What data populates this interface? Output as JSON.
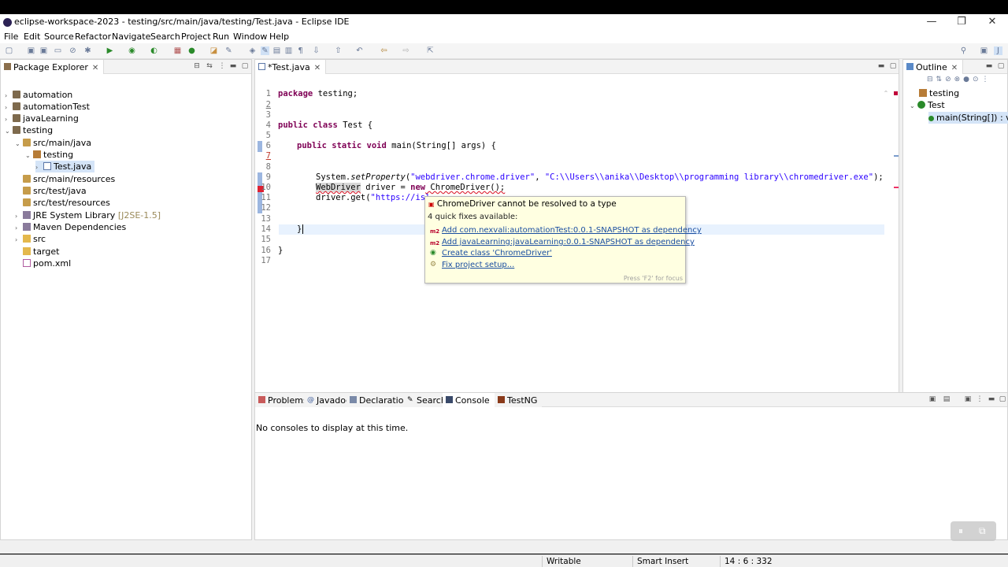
{
  "window": {
    "title": "eclipse-workspace-2023 - testing/src/main/java/testing/Test.java - Eclipse IDE",
    "minimize": "—",
    "maximize": "❐",
    "close": "✕"
  },
  "menu": [
    "File",
    "Edit",
    "Source",
    "Refactor",
    "Navigate",
    "Search",
    "Project",
    "Run",
    "Window",
    "Help"
  ],
  "package_explorer": {
    "tab_label": "Package Explorer",
    "items": [
      {
        "label": "automation",
        "suffix": ""
      },
      {
        "label": "automationTest",
        "suffix": ""
      },
      {
        "label": "javaLearning",
        "suffix": ""
      },
      {
        "label": "testing",
        "suffix": ""
      },
      {
        "label": "src/main/java",
        "suffix": ""
      },
      {
        "label": "testing",
        "suffix": ""
      },
      {
        "label": "Test.java",
        "suffix": ""
      },
      {
        "label": "src/main/resources",
        "suffix": ""
      },
      {
        "label": "src/test/java",
        "suffix": ""
      },
      {
        "label": "src/test/resources",
        "suffix": ""
      },
      {
        "label": "JRE System Library",
        "suffix": "[J2SE-1.5]"
      },
      {
        "label": "Maven Dependencies",
        "suffix": ""
      },
      {
        "label": "src",
        "suffix": ""
      },
      {
        "label": "target",
        "suffix": ""
      },
      {
        "label": "pom.xml",
        "suffix": ""
      }
    ]
  },
  "editor": {
    "tab_label": "*Test.java",
    "line_numbers": [
      "1",
      "2",
      "3",
      "4",
      "5",
      "6",
      "7",
      "8",
      "9",
      "10",
      "11",
      "12",
      "13",
      "14",
      "15",
      "16",
      "17"
    ],
    "lines": {
      "l1_kw": "package",
      "l1_rest": " testing;",
      "l4_kw1": "public",
      "l4_kw2": "class",
      "l4_rest": " Test {",
      "l6_kw1": "public",
      "l6_kw2": "static",
      "l6_kw3": "void",
      "l6_rest": " main(String[] args) {",
      "l9_a": "System.",
      "l9_method": "setProperty",
      "l9_b": "(",
      "l9_str1": "\"webdriver.chrome.driver\"",
      "l9_c": ", ",
      "l9_str2": "\"C:\\\\Users\\\\anika\\\\Desktop\\\\programming library\\\\chromedriver.exe\"",
      "l9_d": ");",
      "l10_a": "WebDriver",
      "l10_b": " driver = ",
      "l10_kw": "new",
      "l10_c": " ChromeDriver();",
      "l11_a": "driver.get(",
      "l11_str": "\"https://isl",
      "l14": "}",
      "l16": "}"
    }
  },
  "quickfix": {
    "title": "ChromeDriver cannot be resolved to a type",
    "subtitle": "4 quick fixes available:",
    "fixes": [
      "Add com.nexvali:automationTest:0.0.1-SNAPSHOT as dependency",
      "Add javaLearning:javaLearning:0.0.1-SNAPSHOT as dependency",
      "Create class 'ChromeDriver'",
      "Fix project setup..."
    ],
    "hint": "Press 'F2' for focus"
  },
  "outline": {
    "tab_label": "Outline",
    "items": [
      "testing",
      "Test",
      "main(String[]) : void"
    ]
  },
  "bottom_panel": {
    "tabs": [
      "Problems",
      "Javadoc",
      "Declaration",
      "Search",
      "Console",
      "TestNG"
    ],
    "message": "No consoles to display at this time."
  },
  "status": {
    "writable": "Writable",
    "insert_mode": "Smart Insert",
    "position": "14 : 6 : 332"
  },
  "colors": {
    "keyword": "#7f0055",
    "string": "#2a00ff",
    "link": "#1a4ea1",
    "popup_bg": "#ffffe1"
  }
}
